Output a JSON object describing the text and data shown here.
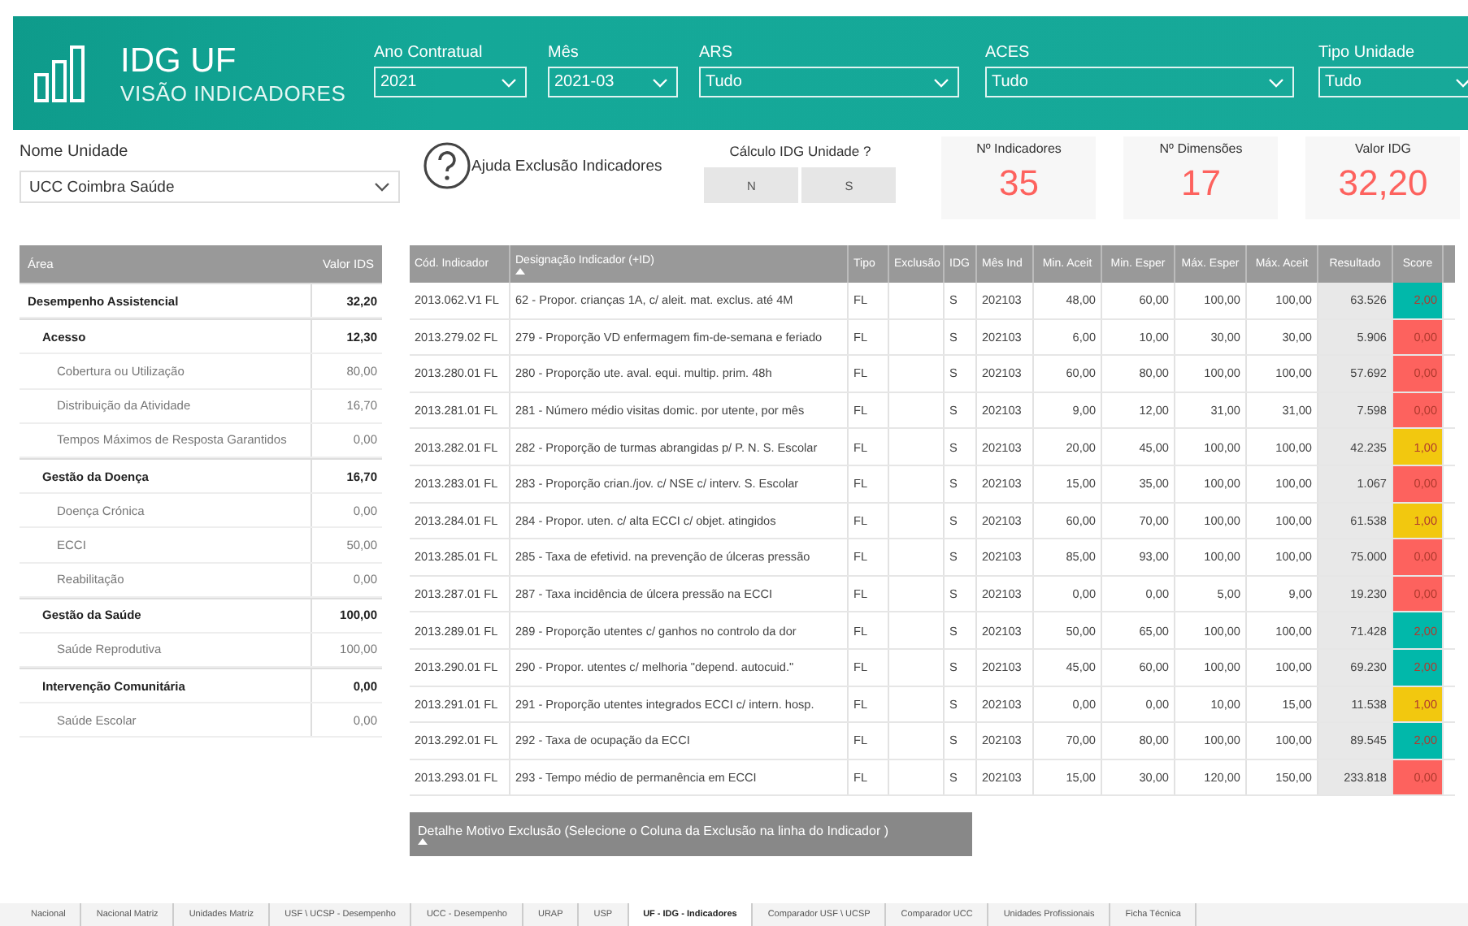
{
  "header": {
    "title": "IDG UF",
    "subtitle": "VISÃO INDICADORES"
  },
  "filters": [
    {
      "label": "Ano Contratual",
      "value": "2021"
    },
    {
      "label": "Mês",
      "value": "2021-03"
    },
    {
      "label": "ARS",
      "value": "Tudo"
    },
    {
      "label": "ACES",
      "value": "Tudo"
    },
    {
      "label": "Tipo Unidade",
      "value": "Tudo"
    }
  ],
  "unit": {
    "label": "Nome Unidade",
    "value": "UCC Coimbra Saúde"
  },
  "help": {
    "label": "Ajuda Exclusão Indicadores"
  },
  "calc": {
    "label": "Cálculo IDG Unidade ?",
    "options": [
      "N",
      "S"
    ]
  },
  "kpis": [
    {
      "label": "Nº Indicadores",
      "value": "35"
    },
    {
      "label": "Nº Dimensões",
      "value": "17"
    },
    {
      "label": "Valor IDG",
      "value": "32,20"
    }
  ],
  "areas": {
    "columns": [
      "Área",
      "Valor IDS"
    ],
    "rows": [
      {
        "name": "Desempenho Assistencial",
        "value": "32,20",
        "children": [
          {
            "name": "Acesso",
            "value": "12,30",
            "children": [
              {
                "name": "Cobertura ou Utilização",
                "value": "80,00"
              },
              {
                "name": "Distribuição da Atividade",
                "value": "16,70"
              },
              {
                "name": "Tempos Máximos de Resposta Garantidos",
                "value": "0,00"
              }
            ]
          },
          {
            "name": "Gestão da Doença",
            "value": "16,70",
            "children": [
              {
                "name": "Doença Crónica",
                "value": "0,00"
              },
              {
                "name": "ECCI",
                "value": "50,00"
              },
              {
                "name": "Reabilitação",
                "value": "0,00"
              }
            ]
          },
          {
            "name": "Gestão da Saúde",
            "value": "100,00",
            "children": [
              {
                "name": "Saúde Reprodutiva",
                "value": "100,00"
              }
            ]
          },
          {
            "name": "Intervenção Comunitária",
            "value": "0,00",
            "children": [
              {
                "name": "Saúde Escolar",
                "value": "0,00"
              }
            ]
          }
        ]
      }
    ]
  },
  "indicators": {
    "columns": [
      "Cód. Indicador",
      "Designação Indicador (+ID)",
      "Tipo",
      "Exclusão",
      "IDG",
      "Mês Ind",
      "Min. Aceit",
      "Min. Esper",
      "Máx. Esper",
      "Máx. Aceit",
      "Resultado",
      "Score"
    ],
    "rows": [
      {
        "cells": [
          "2013.062.V1 FL",
          "62 - Propor. crianças 1A, c/ aleit. mat. exclus. até 4M",
          "FL",
          "",
          "S",
          "202103",
          "48,00",
          "60,00",
          "100,00",
          "100,00",
          "63.526"
        ],
        "score": "2,00",
        "color": "#01b8aa"
      },
      {
        "cells": [
          "2013.279.02 FL",
          "279 - Proporção VD enfermagem fim-de-semana e feriado",
          "FL",
          "",
          "S",
          "202103",
          "6,00",
          "10,00",
          "30,00",
          "30,00",
          "5.906"
        ],
        "score": "0,00",
        "color": "#fd625e"
      },
      {
        "cells": [
          "2013.280.01 FL",
          "280 - Proporção ute. aval. equi. multip. prim. 48h",
          "FL",
          "",
          "S",
          "202103",
          "60,00",
          "80,00",
          "100,00",
          "100,00",
          "57.692"
        ],
        "score": "0,00",
        "color": "#fd625e"
      },
      {
        "cells": [
          "2013.281.01 FL",
          "281 - Número médio visitas domic. por utente, por mês",
          "FL",
          "",
          "S",
          "202103",
          "9,00",
          "12,00",
          "31,00",
          "31,00",
          "7.598"
        ],
        "score": "0,00",
        "color": "#fd625e"
      },
      {
        "cells": [
          "2013.282.01 FL",
          "282 - Proporção de turmas abrangidas p/ P. N. S. Escolar",
          "FL",
          "",
          "S",
          "202103",
          "20,00",
          "45,00",
          "100,00",
          "100,00",
          "42.235"
        ],
        "score": "1,00",
        "color": "#f2c80f"
      },
      {
        "cells": [
          "2013.283.01 FL",
          "283 - Proporção crian./jov. c/ NSE c/ interv. S. Escolar",
          "FL",
          "",
          "S",
          "202103",
          "15,00",
          "35,00",
          "100,00",
          "100,00",
          "1.067"
        ],
        "score": "0,00",
        "color": "#fd625e"
      },
      {
        "cells": [
          "2013.284.01 FL",
          "284 - Propor. uten. c/ alta ECCI c/ objet. atingidos",
          "FL",
          "",
          "S",
          "202103",
          "60,00",
          "70,00",
          "100,00",
          "100,00",
          "61.538"
        ],
        "score": "1,00",
        "color": "#f2c80f"
      },
      {
        "cells": [
          "2013.285.01 FL",
          "285 - Taxa de efetivid. na prevenção de úlceras pressão",
          "FL",
          "",
          "S",
          "202103",
          "85,00",
          "93,00",
          "100,00",
          "100,00",
          "75.000"
        ],
        "score": "0,00",
        "color": "#fd625e"
      },
      {
        "cells": [
          "2013.287.01 FL",
          "287 - Taxa incidência de úlcera pressão na ECCI",
          "FL",
          "",
          "S",
          "202103",
          "0,00",
          "0,00",
          "5,00",
          "9,00",
          "19.230"
        ],
        "score": "0,00",
        "color": "#fd625e"
      },
      {
        "cells": [
          "2013.289.01 FL",
          "289 - Proporção utentes c/ ganhos no controlo da dor",
          "FL",
          "",
          "S",
          "202103",
          "50,00",
          "65,00",
          "100,00",
          "100,00",
          "71.428"
        ],
        "score": "2,00",
        "color": "#01b8aa"
      },
      {
        "cells": [
          "2013.290.01 FL",
          "290 - Propor. utentes c/ melhoria \"depend. autocuid.\"",
          "FL",
          "",
          "S",
          "202103",
          "45,00",
          "60,00",
          "100,00",
          "100,00",
          "69.230"
        ],
        "score": "2,00",
        "color": "#01b8aa"
      },
      {
        "cells": [
          "2013.291.01 FL",
          "291 - Proporção utentes integrados ECCI c/ intern. hosp.",
          "FL",
          "",
          "S",
          "202103",
          "0,00",
          "0,00",
          "10,00",
          "15,00",
          "11.538"
        ],
        "score": "1,00",
        "color": "#f2c80f"
      },
      {
        "cells": [
          "2013.292.01 FL",
          "292 - Taxa de ocupação da ECCI",
          "FL",
          "",
          "S",
          "202103",
          "70,00",
          "80,00",
          "100,00",
          "100,00",
          "89.545"
        ],
        "score": "2,00",
        "color": "#01b8aa"
      },
      {
        "cells": [
          "2013.293.01 FL",
          "293 - Tempo médio de permanência em ECCI",
          "FL",
          "",
          "S",
          "202103",
          "15,00",
          "30,00",
          "120,00",
          "150,00",
          "233.818"
        ],
        "score": "0,00",
        "color": "#fd625e"
      }
    ]
  },
  "detail": {
    "label": "Detalhe Motivo Exclusão (Selecione o Coluna da Exclusão na linha do Indicador )"
  },
  "pages": [
    {
      "label": "Nacional",
      "selected": false
    },
    {
      "label": "Nacional Matriz",
      "selected": false
    },
    {
      "label": "Unidades Matriz",
      "selected": false
    },
    {
      "label": "USF \\ UCSP - Desempenho",
      "selected": false
    },
    {
      "label": "UCC - Desempenho",
      "selected": false
    },
    {
      "label": "URAP",
      "selected": false
    },
    {
      "label": "USP",
      "selected": false
    },
    {
      "label": "UF - IDG - Indicadores",
      "selected": true
    },
    {
      "label": "Comparador USF \\ UCSP",
      "selected": false
    },
    {
      "label": "Comparador UCC",
      "selected": false
    },
    {
      "label": "Unidades Profissionais",
      "selected": false
    },
    {
      "label": "Ficha Técnica",
      "selected": false
    }
  ]
}
